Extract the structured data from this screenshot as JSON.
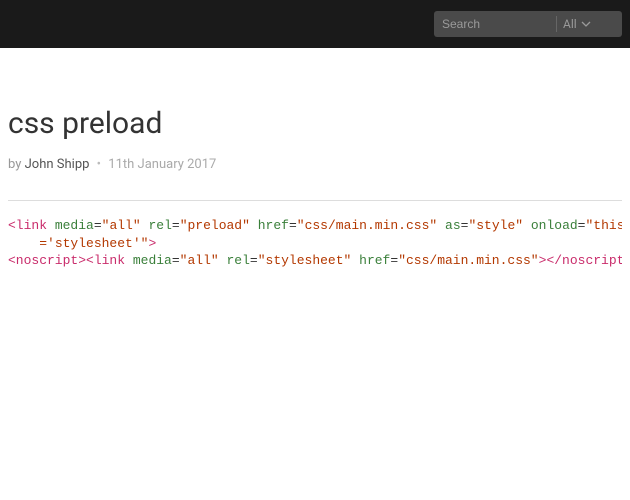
{
  "header": {
    "search_placeholder": "Search",
    "filter_label": "All"
  },
  "post": {
    "title": "css preload",
    "by_label": "by",
    "author": "John Shipp",
    "date": "11th January 2017"
  },
  "code": {
    "line1": {
      "tag_open": "<link",
      "media_attr": "media",
      "media_val": "\"all\"",
      "rel_attr": "rel",
      "rel_val": "\"preload\"",
      "href_attr": "href",
      "href_val": "\"css/main.min.css\"",
      "as_attr": "as",
      "as_val": "\"style\"",
      "onload_attr": "onload",
      "onload_val": "\"this."
    },
    "line2": {
      "cont_val": "='stylesheet'\"",
      "close": ">"
    },
    "line3": {
      "ns_open": "<noscript>",
      "link_open": "<link",
      "media_attr": "media",
      "media_val": "\"all\"",
      "rel_attr": "rel",
      "rel_val": "\"stylesheet\"",
      "href_attr": "href",
      "href_val": "\"css/main.min.css\"",
      "link_close": ">",
      "ns_close": "</noscript>"
    }
  }
}
